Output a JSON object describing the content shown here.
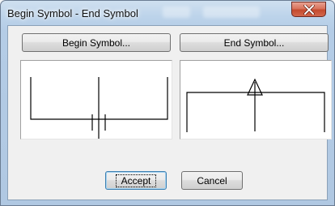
{
  "window": {
    "title": "Begin Symbol - End Symbol",
    "close_label": "x"
  },
  "buttons": {
    "begin_symbol": "Begin Symbol...",
    "end_symbol": "End Symbol...",
    "accept": "Accept",
    "cancel": "Cancel"
  },
  "colors": {
    "frame": "#b4cce6",
    "close_button": "#c44a2d",
    "client": "#f0f0f0",
    "preview_background": "#ffffff",
    "symbol_stroke": "#000000"
  },
  "icons": {
    "close": "close-x-icon",
    "begin_preview": "tick-marks-symbol",
    "end_preview": "arrow-up-symbol"
  }
}
